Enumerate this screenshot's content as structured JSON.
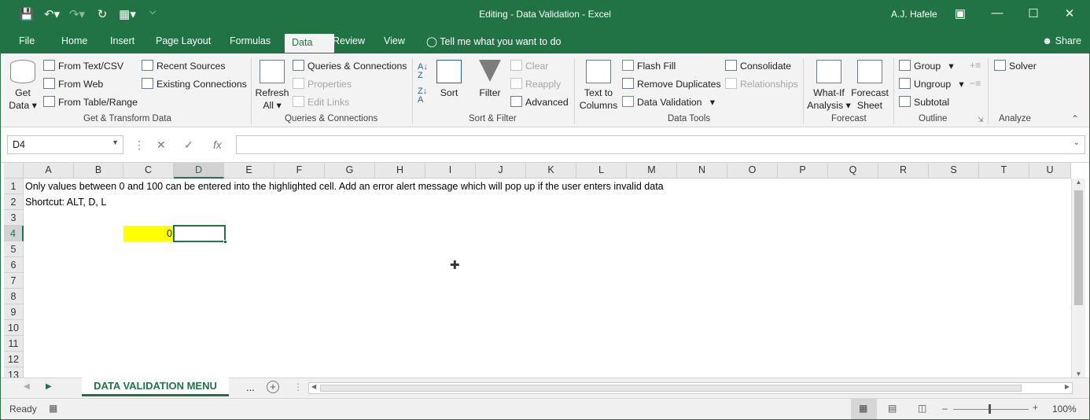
{
  "window": {
    "title": "Editing - Data Validation  -  Excel",
    "user": "A.J. Hafele",
    "qat_icons": [
      "save-icon",
      "undo-icon",
      "redo-icon",
      "refresh-icon",
      "layout-icon",
      "customize-icon"
    ]
  },
  "menu": {
    "tabs": [
      "File",
      "Home",
      "Insert",
      "Page Layout",
      "Formulas",
      "Data",
      "Review",
      "View"
    ],
    "active_tab": "Data",
    "tell_me": "Tell me what you want to do",
    "share": "Share"
  },
  "ribbon": {
    "get_transform": {
      "get_data": "Get Data",
      "from_text_csv": "From Text/CSV",
      "from_web": "From Web",
      "from_table_range": "From Table/Range",
      "recent_sources": "Recent Sources",
      "existing_connections": "Existing Connections",
      "label": "Get & Transform Data"
    },
    "queries": {
      "refresh_all": "Refresh All",
      "queries_connections": "Queries & Connections",
      "properties": "Properties",
      "edit_links": "Edit Links",
      "label": "Queries & Connections"
    },
    "sort_filter": {
      "sort": "Sort",
      "filter": "Filter",
      "clear": "Clear",
      "reapply": "Reapply",
      "advanced": "Advanced",
      "label": "Sort & Filter"
    },
    "data_tools": {
      "text_to_columns": "Text to Columns",
      "flash_fill": "Flash Fill",
      "remove_duplicates": "Remove Duplicates",
      "data_validation": "Data Validation",
      "consolidate": "Consolidate",
      "relationships": "Relationships",
      "label": "Data Tools"
    },
    "forecast": {
      "what_if": "What-If Analysis",
      "forecast_sheet": "Forecast Sheet",
      "label": "Forecast"
    },
    "outline": {
      "group": "Group",
      "ungroup": "Ungroup",
      "subtotal": "Subtotal",
      "label": "Outline"
    },
    "analyze": {
      "solver": "Solver",
      "label": "Analyze"
    }
  },
  "formula_bar": {
    "name_box": "D4",
    "formula": ""
  },
  "sheet": {
    "columns": [
      "A",
      "B",
      "C",
      "D",
      "E",
      "F",
      "G",
      "H",
      "I",
      "J",
      "K",
      "L",
      "M",
      "N",
      "O",
      "P",
      "Q",
      "R",
      "S",
      "T",
      "U"
    ],
    "rows": [
      "1",
      "2",
      "3",
      "4",
      "5",
      "6",
      "7",
      "8",
      "9",
      "10",
      "11",
      "12",
      "13"
    ],
    "a1": "Only values between 0 and 100 can be entered into the highlighted cell.  Add an error alert message which will pop up if the user enters invalid data",
    "a2": "Shortcut: ALT, D, L",
    "c4": "0",
    "active_cell": "D4"
  },
  "sheet_tabs": {
    "active": "DATA VALIDATION MENU",
    "more": "..."
  },
  "status": {
    "ready": "Ready",
    "zoom": "100%"
  },
  "colors": {
    "brand": "#217346",
    "highlight": "#ffff00"
  }
}
